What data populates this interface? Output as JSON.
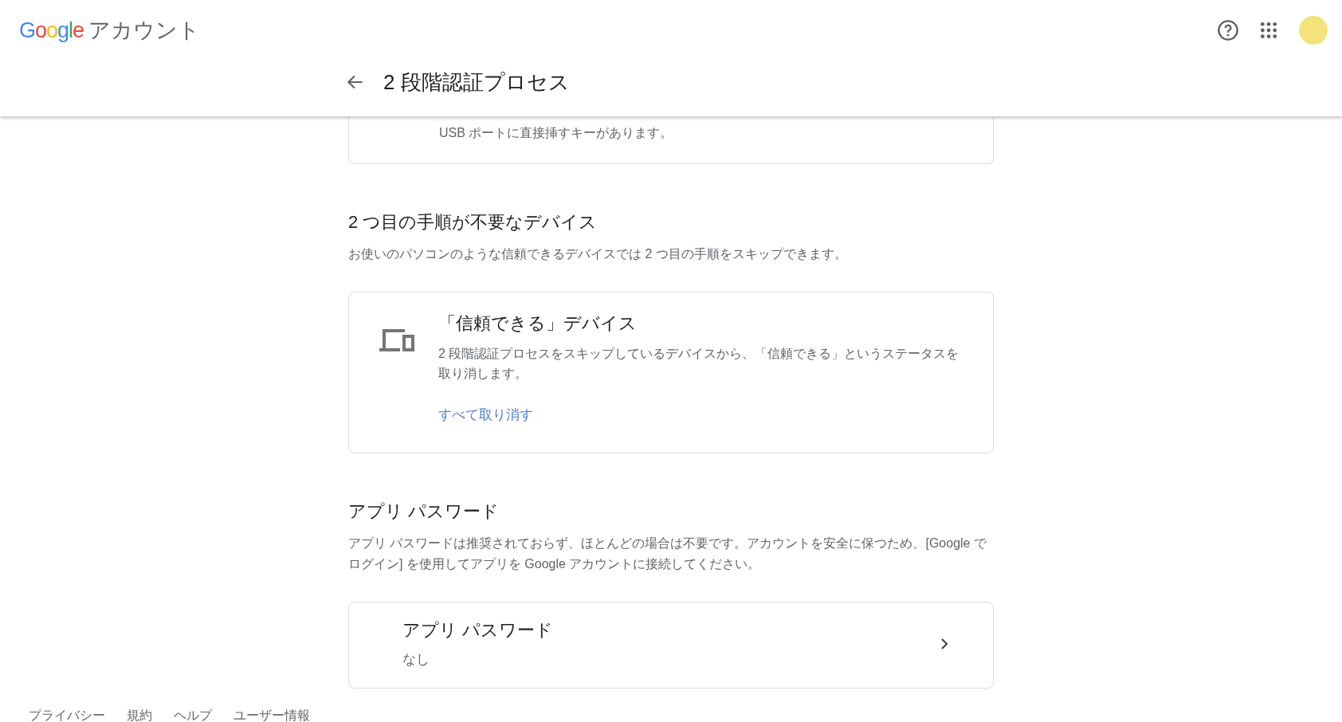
{
  "header": {
    "logo": "Google",
    "product": "アカウント",
    "page_title": "2 段階認証プロセス"
  },
  "security_key_card": {
    "description_tail": "USB ポートに直接挿すキーがあります。"
  },
  "sections": [
    {
      "heading": "2 つ目の手順が不要なデバイス",
      "description": "お使いのパソコンのような信頼できるデバイスでは 2 つ目の手順をスキップできます。",
      "card": {
        "kind": "devices",
        "title": "「信頼できる」デバイス",
        "text": "2 段階認証プロセスをスキップしているデバイスから、「信頼できる」というステータスを取り消します。",
        "link": "すべて取り消す"
      }
    },
    {
      "heading": "アプリ パスワード",
      "description": "アプリ パスワードは推奨されておらず、ほとんどの場合は不要です。アカウントを安全に保つため、[Google でログイン] を使用してアプリを Google アカウントに接続してください。",
      "card": {
        "kind": "nav",
        "title": "アプリ パスワード",
        "text": "なし"
      }
    }
  ],
  "footer": [
    "プライバシー",
    "規約",
    "ヘルプ",
    "ユーザー情報"
  ]
}
